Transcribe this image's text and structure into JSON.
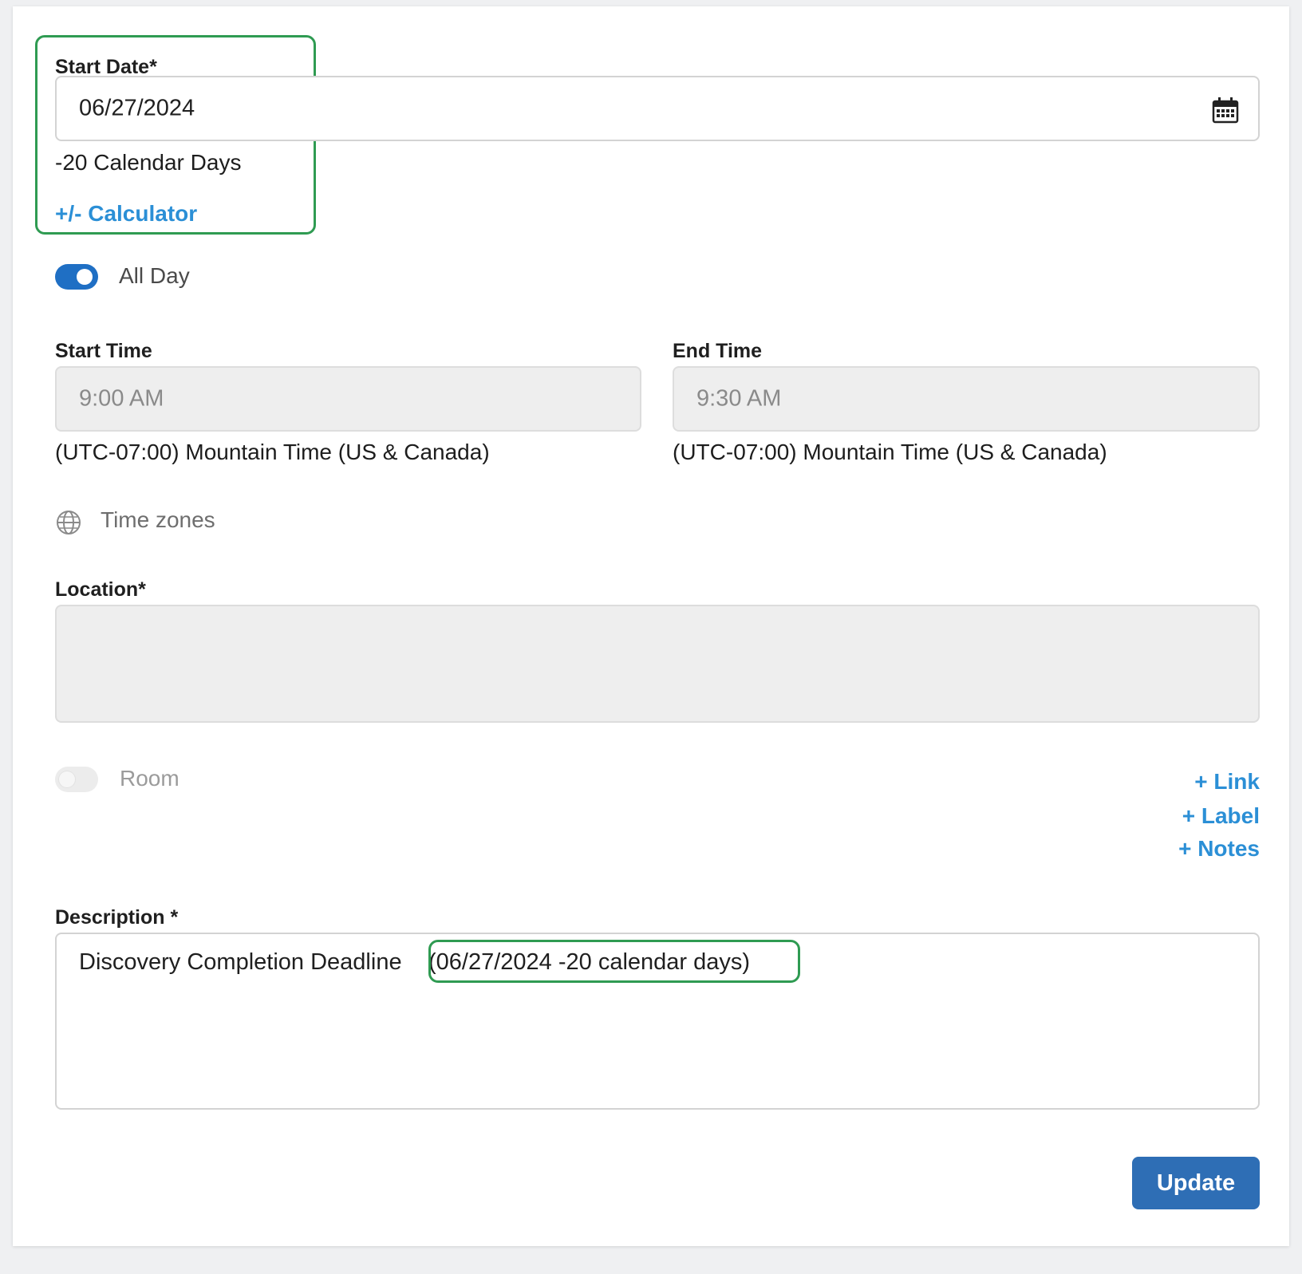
{
  "start_date": {
    "label": "Start Date*",
    "value": "06/27/2024",
    "offset_text": "-20 Calendar Days",
    "calculator_link": "+/- Calculator"
  },
  "all_day": {
    "label": "All Day",
    "enabled": true
  },
  "start_time": {
    "label": "Start Time",
    "value": "9:00 AM",
    "timezone": "(UTC-07:00) Mountain Time (US & Canada)"
  },
  "end_time": {
    "label": "End Time",
    "value": "9:30 AM",
    "timezone": "(UTC-07:00) Mountain Time (US & Canada)"
  },
  "time_zones": {
    "label": "Time zones",
    "icon": "globe-icon"
  },
  "location": {
    "label": "Location*",
    "value": ""
  },
  "room": {
    "label": "Room",
    "enabled": false
  },
  "extras": {
    "link": "+ Link",
    "label": "+ Label",
    "notes": "+ Notes"
  },
  "description": {
    "label": "Description *",
    "main_text": "Discovery Completion Deadline",
    "computed_text": "(06/27/2024 -20 calendar days)"
  },
  "actions": {
    "update_label": "Update"
  },
  "colors": {
    "accent": "#2e6eb5",
    "link": "#2b8fd6",
    "highlight": "#2f9b52",
    "toggle_on": "#1f6fc4"
  }
}
